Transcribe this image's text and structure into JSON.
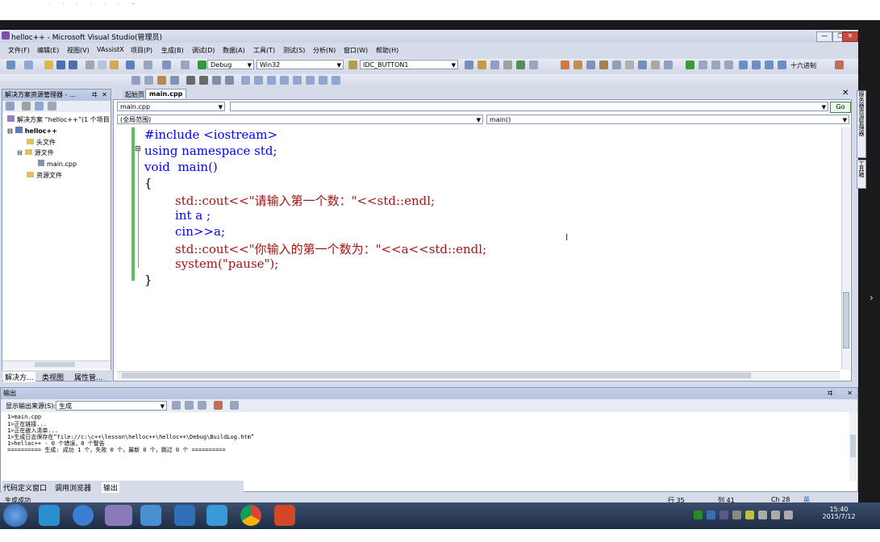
{
  "window": {
    "title": "helloc++ - Microsoft Visual Studio(管理员)",
    "minimize": "—",
    "maximize": "❐",
    "close": "✕"
  },
  "menu": [
    "文件(F)",
    "编辑(E)",
    "视图(V)",
    "VAssistX",
    "项目(P)",
    "生成(B)",
    "调试(D)",
    "数据(A)",
    "工具(T)",
    "测试(S)",
    "分析(N)",
    "窗口(W)",
    "帮助(H)"
  ],
  "toolbar": {
    "config": "Debug",
    "platform": "Win32",
    "find_combo": "IDC_BUTTON1",
    "hex_label": "十六进制"
  },
  "solution_explorer": {
    "title": "解决方案资源管理器 - ...",
    "pin": "ヰ",
    "close": "✕",
    "items": [
      "解决方案 “helloc++”(1 个项目",
      "helloc++",
      "头文件",
      "源文件",
      "main.cpp",
      "资源文件"
    ],
    "tabs": [
      "解决方...",
      "类视图",
      "属性管..."
    ]
  },
  "editor": {
    "tabs": [
      "起始页",
      "main.cpp"
    ],
    "file_combo": "main.cpp",
    "scope_combo": "(全局范围)",
    "member_combo": "main()",
    "go_button": "Go",
    "code": [
      "#include <iostream>",
      "using namespace std;",
      "void  main()",
      "{",
      "std::cout<<\"请输入第一个数：\"<<std::endl;",
      "int a ;",
      "cin>>a;",
      "std::cout<<\"你输入的第一个数为：\"<<a<<std::endl;",
      "system(\"pause\");",
      "}"
    ]
  },
  "output": {
    "title": "输出",
    "source_label": "显示输出来源(S):",
    "source_value": "生成",
    "lines": [
      "1>main.cpp",
      "1>正在链接...",
      "1>正在嵌入清单...",
      "1>生成日志保存在“file://c:\\c++\\lesson\\helloc++\\helloc++\\Debug\\BuildLog.htm”",
      "1>helloc++ - 0 个错误，0 个警告",
      "========== 生成: 成功 1 个，失败 0 个，最新 0 个，跳过 0 个 =========="
    ],
    "tabs": [
      "代码定义窗口",
      "调用浏览器",
      "输出"
    ]
  },
  "status": {
    "message": "生成成功",
    "row": "行 35",
    "col": "列 41",
    "ch": "Ch 28",
    "ime": "英"
  },
  "side_tabs": [
    "服务器资源管理器",
    "工具箱"
  ],
  "taskbar": {
    "time": "15:40",
    "date": "2015/7/12"
  },
  "colors": {
    "keyword": "#0000ff",
    "string": "#a31515",
    "chrome": "#d6dbe9"
  }
}
